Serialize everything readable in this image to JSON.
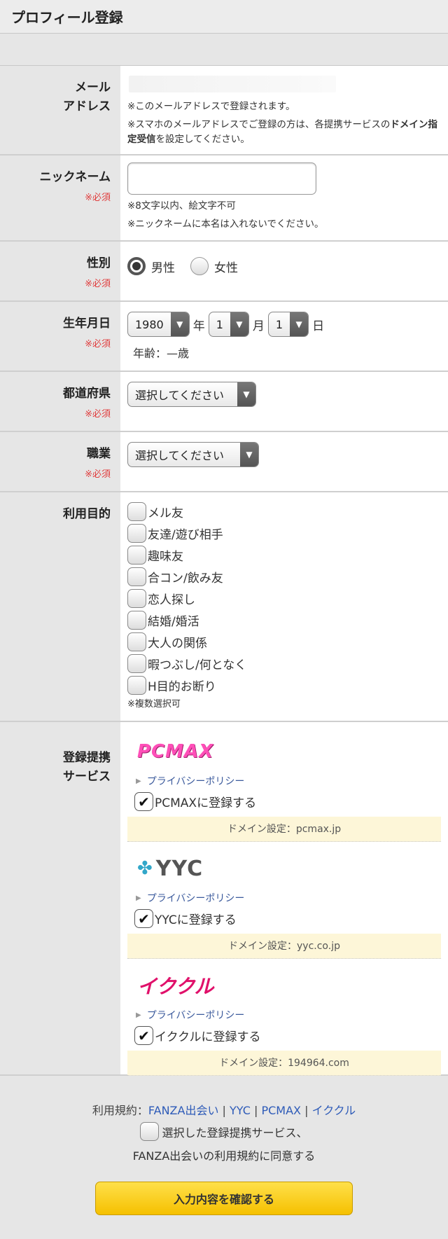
{
  "header": {
    "title": "プロフィール登録"
  },
  "email": {
    "label_line1": "メール",
    "label_line2": "アドレス",
    "note1": "※このメールアドレスで登録されます。",
    "note2_pre": "※スマホのメールアドレスでご登録の方は、各提携サービスの",
    "note2_bold": "ドメイン指定受信",
    "note2_post": "を設定してください。"
  },
  "nickname": {
    "label": "ニックネーム",
    "required": "※必須",
    "value": "",
    "note1": "※8文字以内、絵文字不可",
    "note2": "※ニックネームに本名は入れないでください。"
  },
  "gender": {
    "label": "性別",
    "required": "※必須",
    "male": "男性",
    "female": "女性",
    "selected": "male"
  },
  "birthdate": {
    "label": "生年月日",
    "required": "※必須",
    "year": "1980",
    "year_unit": "年",
    "month": "1",
    "month_unit": "月",
    "day": "1",
    "day_unit": "日",
    "age_text": "年齢：—歳"
  },
  "prefecture": {
    "label": "都道府県",
    "required": "※必須",
    "value": "選択してください"
  },
  "occupation": {
    "label": "職業",
    "required": "※必須",
    "value": "選択してください"
  },
  "purpose": {
    "label": "利用目的",
    "options": [
      "メル友",
      "友達/遊び相手",
      "趣味友",
      "合コン/飲み友",
      "恋人探し",
      "結婚/婚活",
      "大人の関係",
      "暇つぶし/何となく",
      "H目的お断り"
    ],
    "note": "※複数選択可"
  },
  "services": {
    "label_line1": "登録提携",
    "label_line2": "サービス",
    "items": [
      {
        "logo": "PCMAX",
        "policy": "プライバシーポリシー",
        "register": "PCMAXに登録する",
        "domain": "ドメイン設定：pcmax.jp",
        "checked": true
      },
      {
        "logo": "YYC",
        "policy": "プライバシーポリシー",
        "register": "YYCに登録する",
        "domain": "ドメイン設定：yyc.co.jp",
        "checked": true
      },
      {
        "logo": "イククル",
        "policy": "プライバシーポリシー",
        "register": "イククルに登録する",
        "domain": "ドメイン設定：194964.com",
        "checked": true
      }
    ]
  },
  "footer": {
    "terms_prefix": "利用規約：",
    "links": [
      "FANZA出会い",
      "YYC",
      "PCMAX",
      "イククル"
    ],
    "separator": "|",
    "agree_line1": "選択した登録提携サービス、",
    "agree_line2": "FANZA出会いの利用規約に同意する",
    "submit": "入力内容を確認する"
  },
  "colors": {
    "required": "#e03c3c",
    "link": "#2e5bb8",
    "button": "#f5c000",
    "domain_bg": "#fdf6d8"
  }
}
